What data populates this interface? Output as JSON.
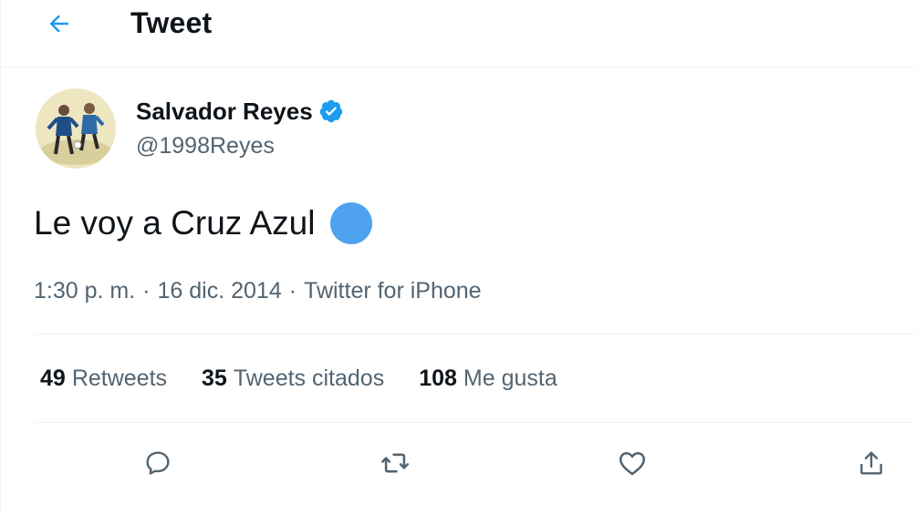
{
  "header": {
    "back_icon": "arrow-left-icon",
    "title": "Tweet"
  },
  "author": {
    "name": "Salvador Reyes",
    "handle": "@1998Reyes",
    "verified_icon": "verified-badge-icon",
    "verified_color": "#1d9bf0"
  },
  "tweet": {
    "text": "Le voy a Cruz Azul",
    "emoji": "blue-circle-emoji",
    "emoji_color": "#4fa3ee"
  },
  "meta": {
    "time": "1:30 p. m.",
    "separator": "·",
    "date": "16 dic. 2014",
    "source": "Twitter for iPhone"
  },
  "stats": [
    {
      "count": "49",
      "label": "Retweets"
    },
    {
      "count": "35",
      "label": "Tweets citados"
    },
    {
      "count": "108",
      "label": "Me gusta"
    }
  ],
  "actions": [
    {
      "icon": "reply-icon"
    },
    {
      "icon": "retweet-icon"
    },
    {
      "icon": "like-icon"
    },
    {
      "icon": "share-icon"
    }
  ],
  "colors": {
    "accent": "#1d9bf0",
    "text": "#0f1419",
    "secondary_text": "#536471",
    "divider": "#eff3f4"
  }
}
